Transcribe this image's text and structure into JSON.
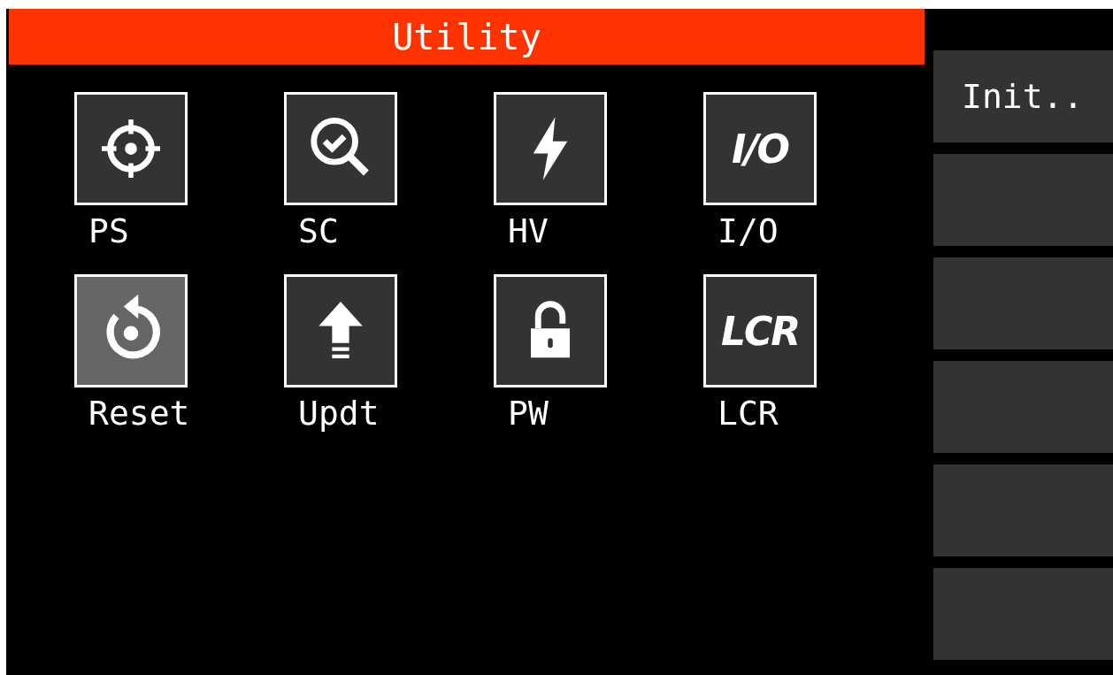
{
  "title": "Utility",
  "tiles": [
    {
      "label": "PS",
      "kind": "target",
      "selected": false
    },
    {
      "label": "SC",
      "kind": "search-check",
      "selected": false
    },
    {
      "label": "HV",
      "kind": "bolt",
      "selected": false
    },
    {
      "label": "I/O",
      "kind": "text",
      "icon_text": "I/O",
      "selected": false
    },
    {
      "label": "Reset",
      "kind": "reset",
      "selected": true
    },
    {
      "label": "Updt",
      "kind": "upload",
      "selected": false
    },
    {
      "label": "PW",
      "kind": "lock",
      "selected": false
    },
    {
      "label": "LCR",
      "kind": "text",
      "icon_text": "LCR",
      "selected": false
    }
  ],
  "softkeys": [
    {
      "kind": "labeled",
      "label": "Init.."
    },
    {
      "kind": "blank"
    },
    {
      "kind": "blank"
    },
    {
      "kind": "blank"
    },
    {
      "kind": "blank"
    },
    {
      "kind": "blank"
    }
  ]
}
